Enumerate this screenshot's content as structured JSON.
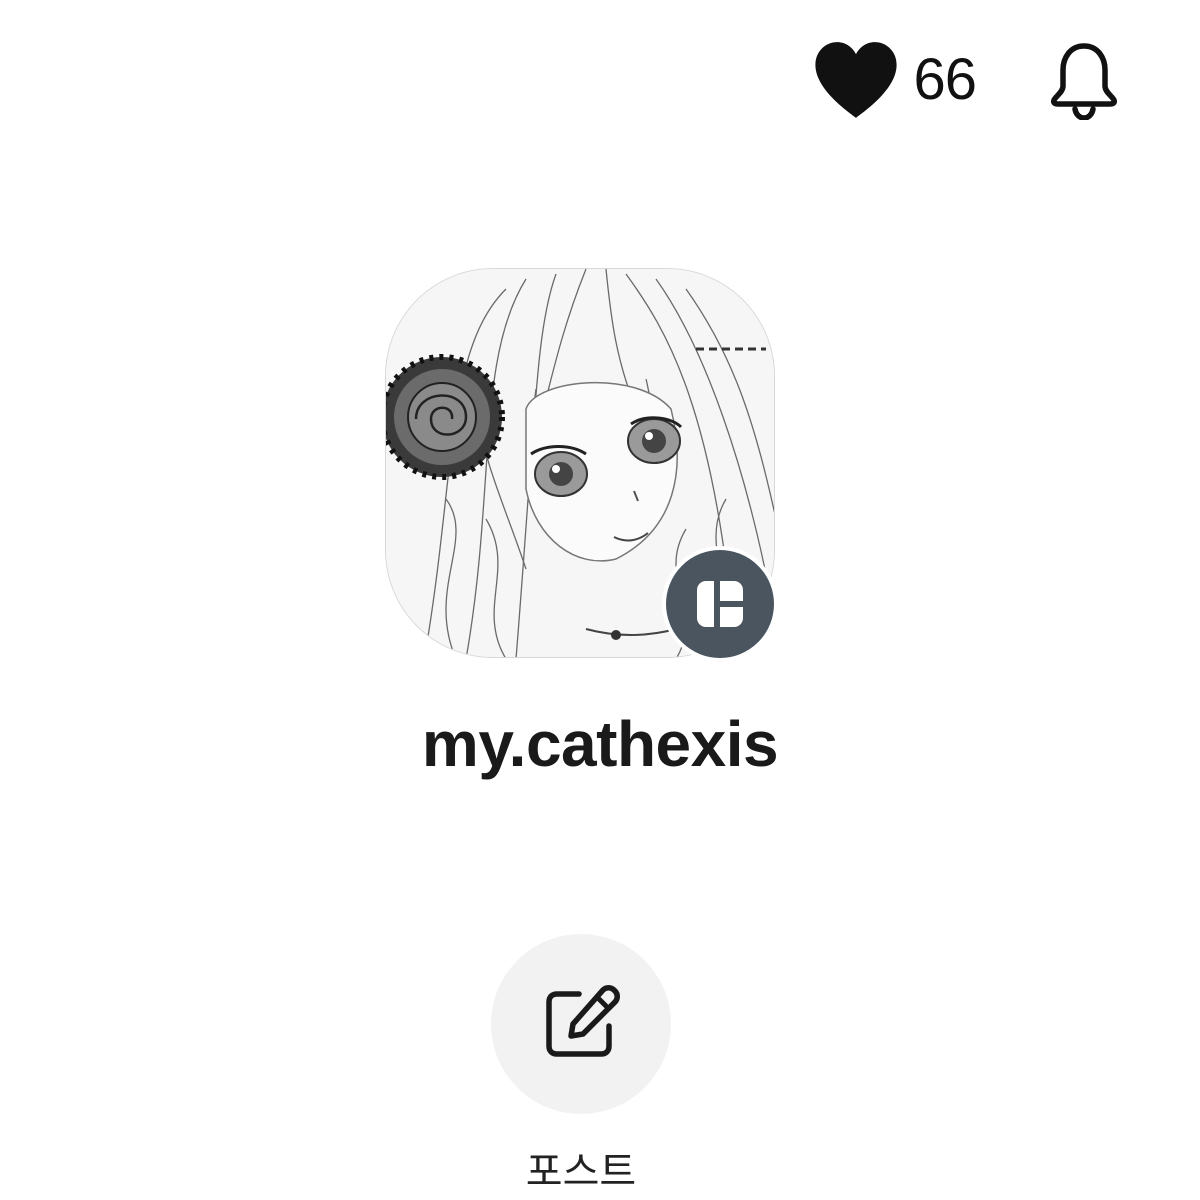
{
  "header": {
    "likes_count": "66",
    "heart_icon": "heart-icon",
    "bell_icon": "bell-icon"
  },
  "profile": {
    "username": "my.cathexis",
    "avatar_description": "manga-girl-with-rose",
    "badge_icon": "layout-grid-icon"
  },
  "actions": {
    "post_label": "포스트",
    "post_icon": "edit-icon"
  },
  "colors": {
    "text": "#111111",
    "badge_bg": "#4b5560",
    "action_bg": "#f2f2f2"
  }
}
